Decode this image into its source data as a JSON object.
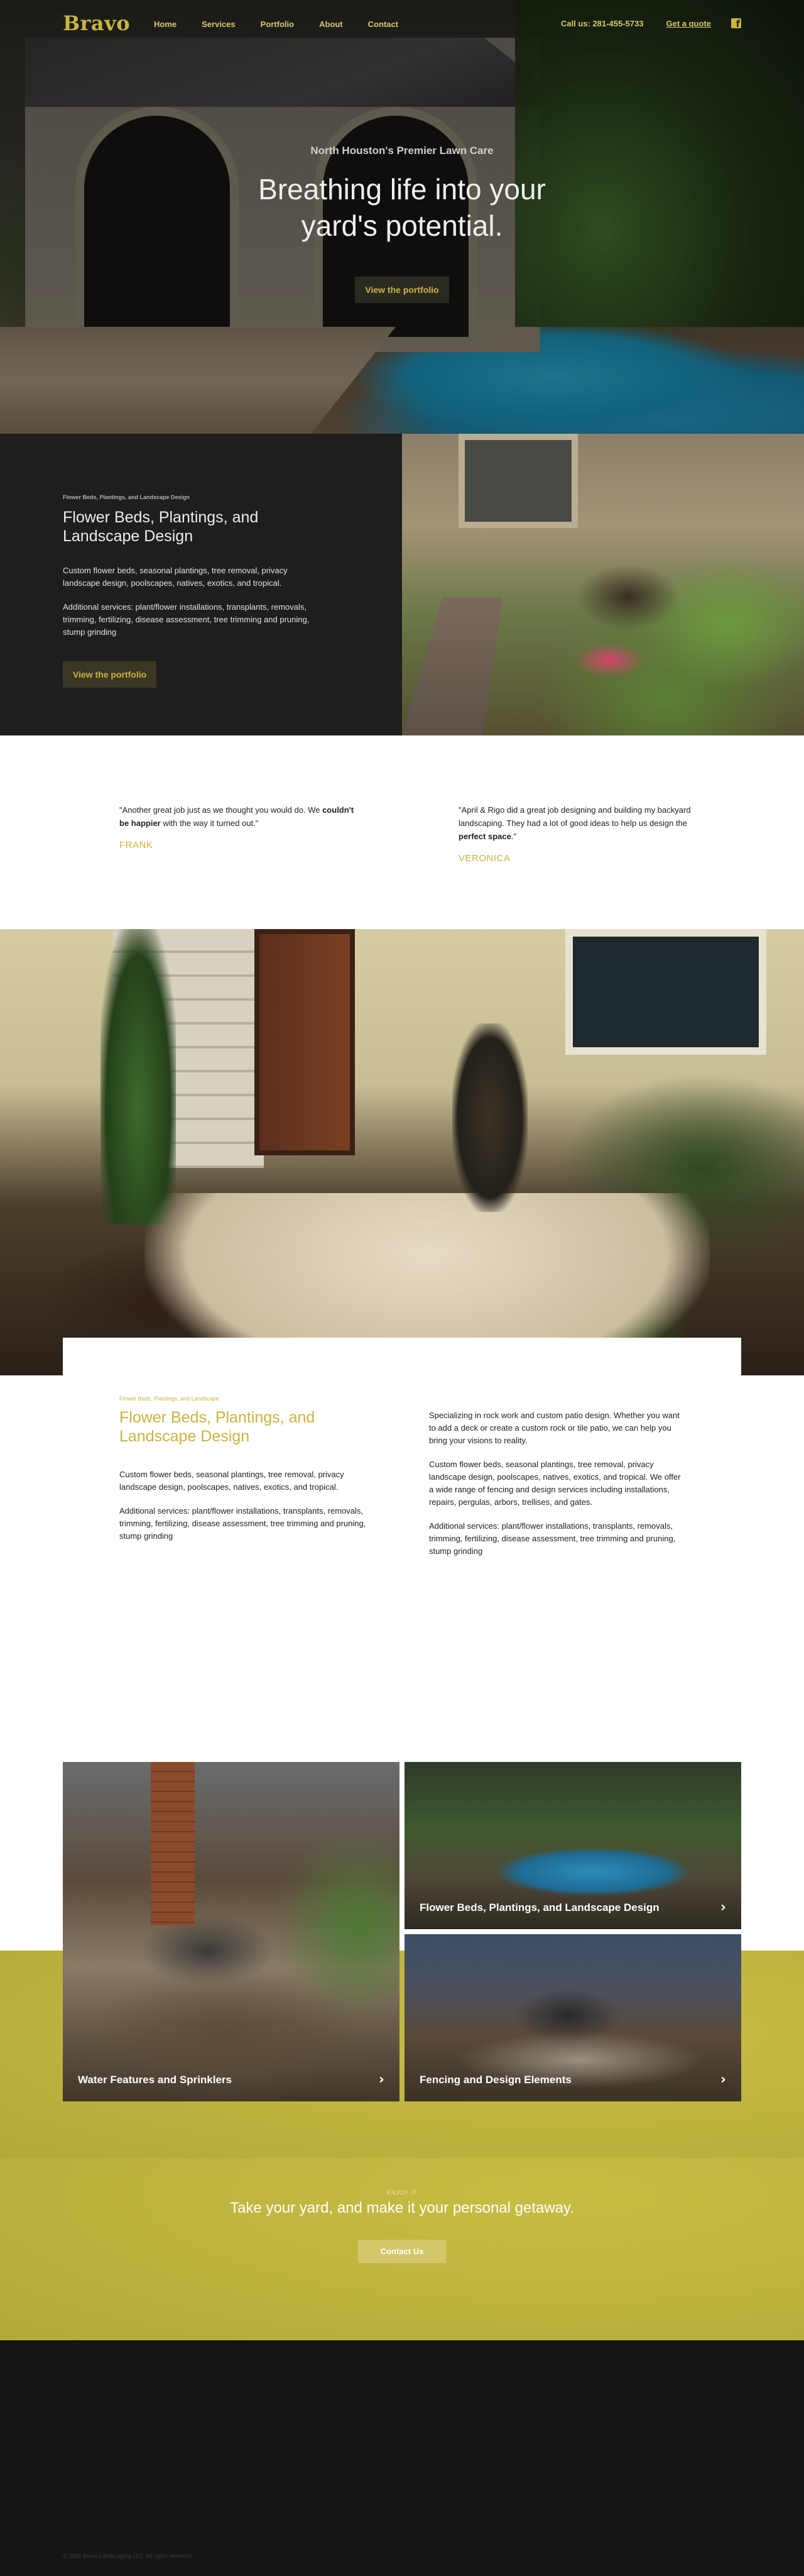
{
  "brand": {
    "logo": "Bravo"
  },
  "nav": {
    "links": [
      "Home",
      "Services",
      "Portfolio",
      "About",
      "Contact"
    ],
    "phone": "Call us: 281-455-5733",
    "quote": "Get a quote",
    "social_icon": "facebook-icon"
  },
  "hero": {
    "kicker": "North Houston's Premier Lawn Care",
    "title": "Breathing life into your yard's potential.",
    "button": "View the portfolio"
  },
  "feature": {
    "eyebrow": "Flower Beds, Plantings, and Landscape Design",
    "title": "Flower Beds, Plantings, and Landscape Design",
    "p1": "Custom flower beds, seasonal plantings, tree removal, privacy landscape design, poolscapes, natives, exotics, and tropical.",
    "p2": "Additional services: plant/flower installations, transplants, removals, trimming, fertilizing, disease assessment, tree trimming and pruning, stump grinding",
    "button": "View the portfolio"
  },
  "testimonials": [
    {
      "pre": "\"Another great job just as we thought you would do.  We ",
      "bold": "couldn't be happier",
      "post": " with the way it turned out.\"",
      "name": "FRANK"
    },
    {
      "pre": "\"April & Rigo did a great job designing and building my backyard landscaping. They had a lot of good ideas to help us design the ",
      "bold": "perfect space",
      "post": ".\"",
      "name": "VERONICA"
    }
  ],
  "service": {
    "eyebrow": "Flower Beds, Plantings, and Landscape",
    "title": "Flower Beds, Plantings, and Landscape Design",
    "left_p1": "Custom flower beds, seasonal plantings, tree removal, privacy landscape design, poolscapes, natives, exotics, and tropical.",
    "left_p2": "Additional services: plant/flower installations, transplants, removals, trimming, fertilizing, disease assessment, tree trimming and pruning, stump grinding",
    "right_p1": "Specializing in rock work and custom patio design.  Whether you want to add a deck or create a custom rock or tile patio, we can help you bring your visions to reality.",
    "right_p2": "Custom flower beds, seasonal plantings, tree removal, privacy landscape design, poolscapes, natives, exotics, and tropical. We offer a wide range of fencing and design services including installations, repairs, pergulas, arbors, trellises, and gates.",
    "right_p3": "Additional services: plant/flower installations, transplants, removals, trimming, fertilizing, disease assessment, tree trimming and pruning, stump grinding"
  },
  "gallery": [
    {
      "label": "Water Features and Sprinklers"
    },
    {
      "label": "Flower Beds, Plantings, and Landscape Design"
    },
    {
      "label": "Fencing and Design Elements"
    }
  ],
  "cta": {
    "kicker": "ENJOY IT",
    "title": "Take your yard, and make it your personal getaway.",
    "button": "Contact Us"
  },
  "footer": {
    "copyright": "© 2016 Bravo Landscaping LLC. All rights reserved."
  },
  "colors": {
    "accent": "#c9b441",
    "dark": "#1e1e1e",
    "cta": "#bcb23e"
  }
}
